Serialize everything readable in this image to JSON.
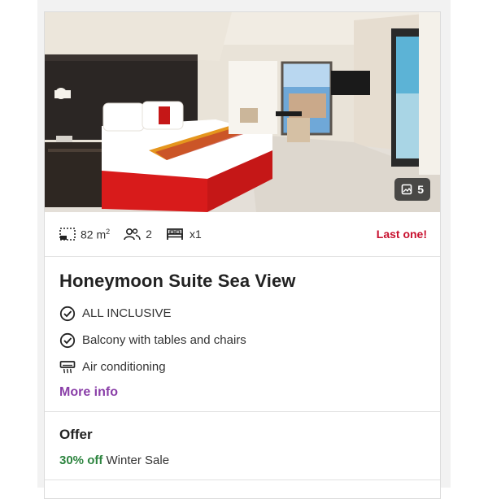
{
  "room": {
    "photo_count": "5",
    "facts": {
      "size": "82 m",
      "size_unit_sup": "2",
      "guests": "2",
      "beds": "x1"
    },
    "availability": "Last one!",
    "title": "Honeymoon Suite Sea View",
    "amenities": [
      {
        "icon": "check-circle-icon",
        "label": "ALL INCLUSIVE"
      },
      {
        "icon": "check-circle-icon",
        "label": "Balcony with tables and chairs"
      },
      {
        "icon": "air-conditioning-icon",
        "label": "Air conditioning"
      }
    ],
    "more_info": "More info"
  },
  "offer": {
    "title": "Offer",
    "discount": "30% off",
    "name": "Winter Sale"
  },
  "colors": {
    "last_one": "#c8102e",
    "link": "#8a3fa8",
    "discount": "#2e8540"
  }
}
